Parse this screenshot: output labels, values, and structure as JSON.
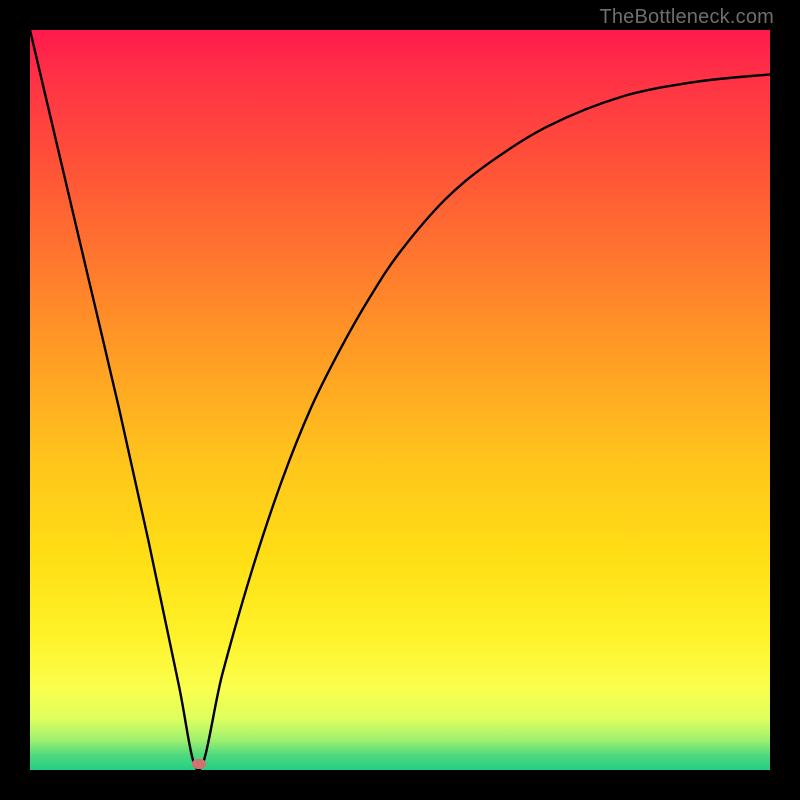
{
  "watermark": "TheBottleneck.com",
  "marker": {
    "x_pct": 22.8,
    "y_pct": 99.2
  },
  "chart_data": {
    "type": "line",
    "title": "",
    "xlabel": "",
    "ylabel": "",
    "xlim": [
      0,
      100
    ],
    "ylim": [
      0,
      100
    ],
    "grid": false,
    "legend": false,
    "annotations": [
      "TheBottleneck.com"
    ],
    "series": [
      {
        "name": "bottleneck-curve",
        "x": [
          0,
          4,
          8,
          12,
          16,
          20,
          22.8,
          26,
          30,
          34,
          38,
          42,
          46,
          50,
          56,
          62,
          70,
          80,
          90,
          100
        ],
        "y": [
          100,
          83,
          66,
          49,
          31,
          12,
          0,
          13,
          27,
          39,
          49,
          57,
          64,
          70,
          77,
          82,
          87,
          91,
          93,
          94
        ]
      }
    ],
    "background_gradient": {
      "direction": "vertical",
      "stops": [
        {
          "pos": 0.0,
          "color": "#ff1a4d"
        },
        {
          "pos": 0.18,
          "color": "#ff5138"
        },
        {
          "pos": 0.45,
          "color": "#ffa024"
        },
        {
          "pos": 0.72,
          "color": "#ffe015"
        },
        {
          "pos": 0.93,
          "color": "#e0ff5e"
        },
        {
          "pos": 1.0,
          "color": "#22cf84"
        }
      ]
    }
  }
}
